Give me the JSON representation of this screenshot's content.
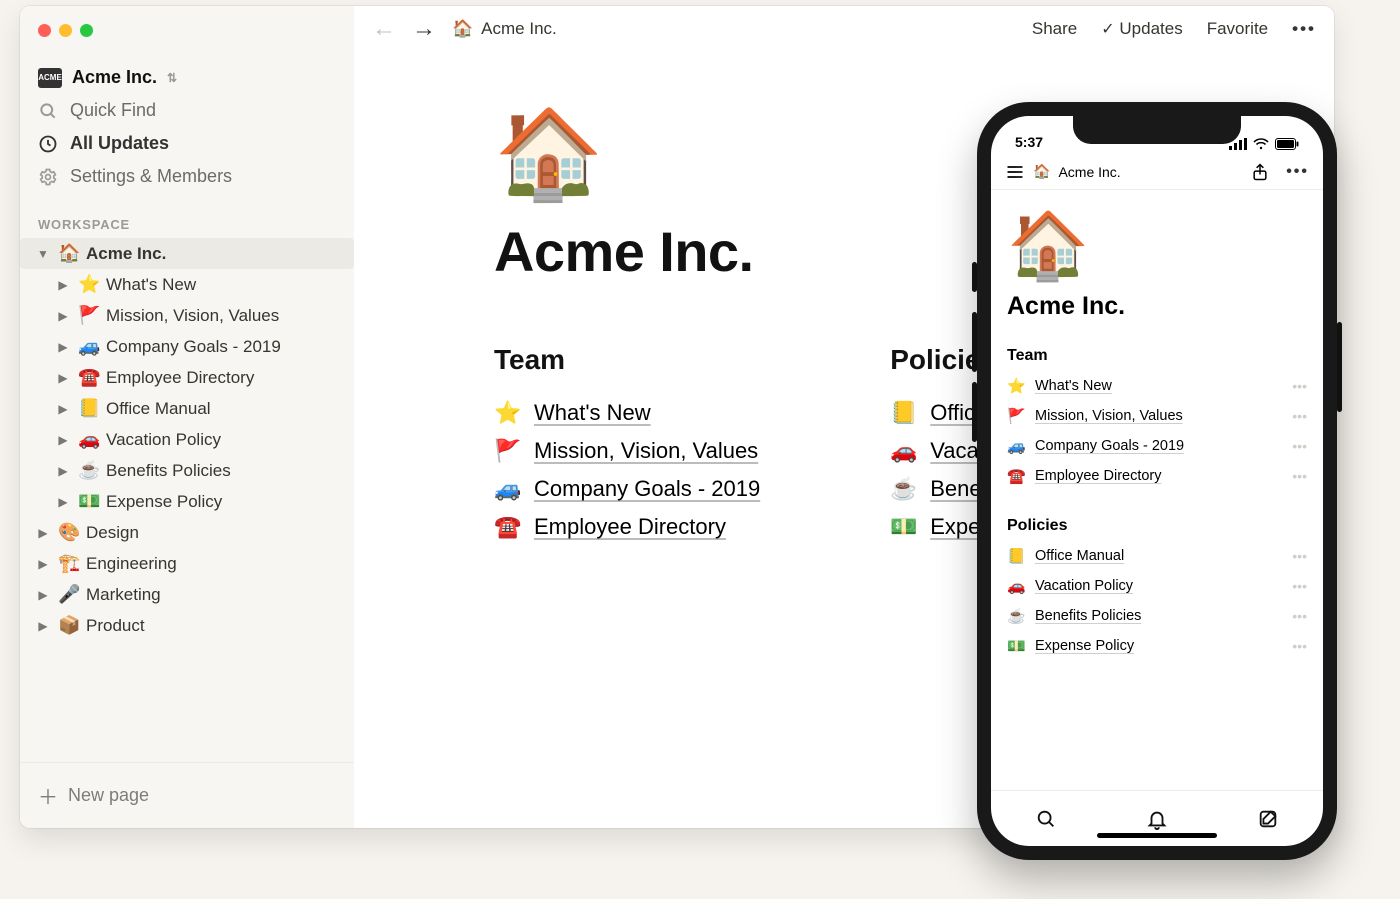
{
  "workspace": {
    "name": "Acme Inc.",
    "badge": "ACME"
  },
  "sidebar": {
    "quick_find_label": "Quick Find",
    "all_updates_label": "All Updates",
    "settings_label": "Settings & Members",
    "section_label": "WORKSPACE",
    "new_page_label": "New page",
    "root": {
      "emoji": "🏠",
      "label": "Acme Inc."
    },
    "children": [
      {
        "emoji": "⭐",
        "label": "What's New"
      },
      {
        "emoji": "🚩",
        "label": "Mission, Vision, Values"
      },
      {
        "emoji": "🚙",
        "label": "Company Goals - 2019"
      },
      {
        "emoji": "☎️",
        "label": "Employee Directory"
      },
      {
        "emoji": "📒",
        "label": "Office Manual"
      },
      {
        "emoji": "🚗",
        "label": "Vacation Policy"
      },
      {
        "emoji": "☕",
        "label": "Benefits Policies"
      },
      {
        "emoji": "💵",
        "label": "Expense Policy"
      }
    ],
    "siblings": [
      {
        "emoji": "🎨",
        "label": "Design"
      },
      {
        "emoji": "🏗️",
        "label": "Engineering"
      },
      {
        "emoji": "🎤",
        "label": "Marketing"
      },
      {
        "emoji": "📦",
        "label": "Product"
      }
    ]
  },
  "topbar": {
    "breadcrumb_emoji": "🏠",
    "breadcrumb": "Acme Inc.",
    "share": "Share",
    "updates": "Updates",
    "favorite": "Favorite"
  },
  "page": {
    "cover_emoji": "🏠",
    "title": "Acme Inc.",
    "columns": [
      {
        "heading": "Team",
        "links": [
          {
            "emoji": "⭐",
            "label": "What's New"
          },
          {
            "emoji": "🚩",
            "label": "Mission, Vision, Values"
          },
          {
            "emoji": "🚙",
            "label": "Company Goals - 2019"
          },
          {
            "emoji": "☎️",
            "label": "Employee Directory"
          }
        ]
      },
      {
        "heading": "Policies",
        "links": [
          {
            "emoji": "📒",
            "label": "Office Manual"
          },
          {
            "emoji": "🚗",
            "label": "Vacation Policy"
          },
          {
            "emoji": "☕",
            "label": "Benefits Policies"
          },
          {
            "emoji": "💵",
            "label": "Expense Policy"
          }
        ]
      }
    ]
  },
  "mobile": {
    "clock": "5:37",
    "breadcrumb_emoji": "🏠",
    "breadcrumb": "Acme Inc.",
    "cover_emoji": "🏠",
    "title": "Acme Inc.",
    "sections": [
      {
        "heading": "Team",
        "items": [
          {
            "emoji": "⭐",
            "label": "What's New"
          },
          {
            "emoji": "🚩",
            "label": "Mission, Vision, Values"
          },
          {
            "emoji": "🚙",
            "label": "Company Goals - 2019"
          },
          {
            "emoji": "☎️",
            "label": "Employee Directory"
          }
        ]
      },
      {
        "heading": "Policies",
        "items": [
          {
            "emoji": "📒",
            "label": "Office Manual"
          },
          {
            "emoji": "🚗",
            "label": "Vacation Policy"
          },
          {
            "emoji": "☕",
            "label": "Benefits Policies"
          },
          {
            "emoji": "💵",
            "label": "Expense Policy"
          }
        ]
      }
    ]
  }
}
